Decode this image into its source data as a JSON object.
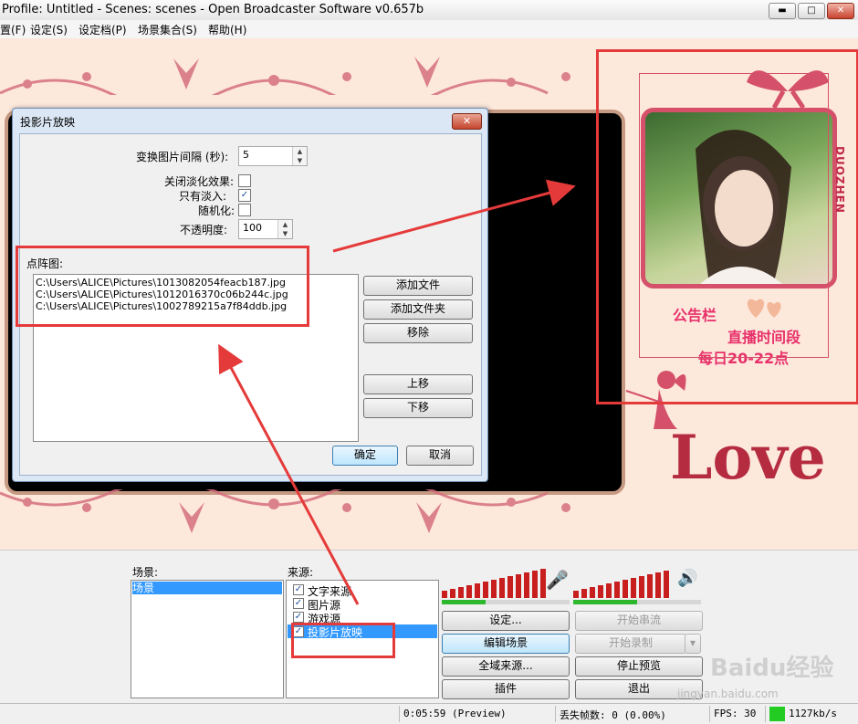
{
  "window": {
    "title": "Profile: Untitled - Scenes: scenes - Open Broadcaster Software v0.657b",
    "min": "▬",
    "max": "□",
    "close": "✕"
  },
  "menu": [
    "置(F)",
    "设定(S)",
    "设定档(P)",
    "场景集合(S)",
    "帮助(H)"
  ],
  "notice": {
    "brand": "DUOZHEN",
    "board": "公告栏",
    "time_title": "直播时间段",
    "time_value": "每日20-22点",
    "love": "Love"
  },
  "dialog": {
    "title": "投影片放映",
    "close": "✕",
    "interval_label": "变换图片间隔 (秒):",
    "interval_value": "5",
    "fade_off_label": "关闭淡化效果:",
    "fade_off_checked": false,
    "fade_in_label": "只有淡入:",
    "fade_in_checked": true,
    "random_label": "随机化:",
    "random_checked": false,
    "opacity_label": "不透明度:",
    "opacity_value": "100",
    "bitmap_label": "点阵图:",
    "files": [
      "C:\\Users\\ALICE\\Pictures\\1013082054feacb187.jpg",
      "C:\\Users\\ALICE\\Pictures\\1012016370c06b244c.jpg",
      "C:\\Users\\ALICE\\Pictures\\1002789215a7f84ddb.jpg"
    ],
    "add_file": "添加文件",
    "add_folder": "添加文件夹",
    "remove": "移除",
    "move_up": "上移",
    "move_down": "下移",
    "ok": "确定",
    "cancel": "取消"
  },
  "bottom": {
    "scenes_label": "场景:",
    "scenes": [
      "场景"
    ],
    "sources_label": "来源:",
    "sources": [
      {
        "name": "文字来源",
        "checked": true
      },
      {
        "name": "图片源",
        "checked": true
      },
      {
        "name": "游戏源",
        "checked": true
      },
      {
        "name": "投影片放映",
        "checked": true
      }
    ],
    "settings": "设定...",
    "edit_scene": "编辑场景",
    "global_sources": "全域来源...",
    "plugins": "插件",
    "start_stream": "开始串流",
    "start_record": "开始录制",
    "stop_preview": "停止预览",
    "exit": "退出",
    "mic_icon": "🎤",
    "speaker_icon": "🔊"
  },
  "status": {
    "time": "0:05:59 (Preview)",
    "dropped": "丢失帧数: 0 (0.00%)",
    "fps": "FPS: 30",
    "bitrate": "1127kb/s",
    "bitrate_color": "#22cc22"
  },
  "watermark": {
    "logo": "Baidu经验",
    "url": "jingyan.baidu.com"
  }
}
